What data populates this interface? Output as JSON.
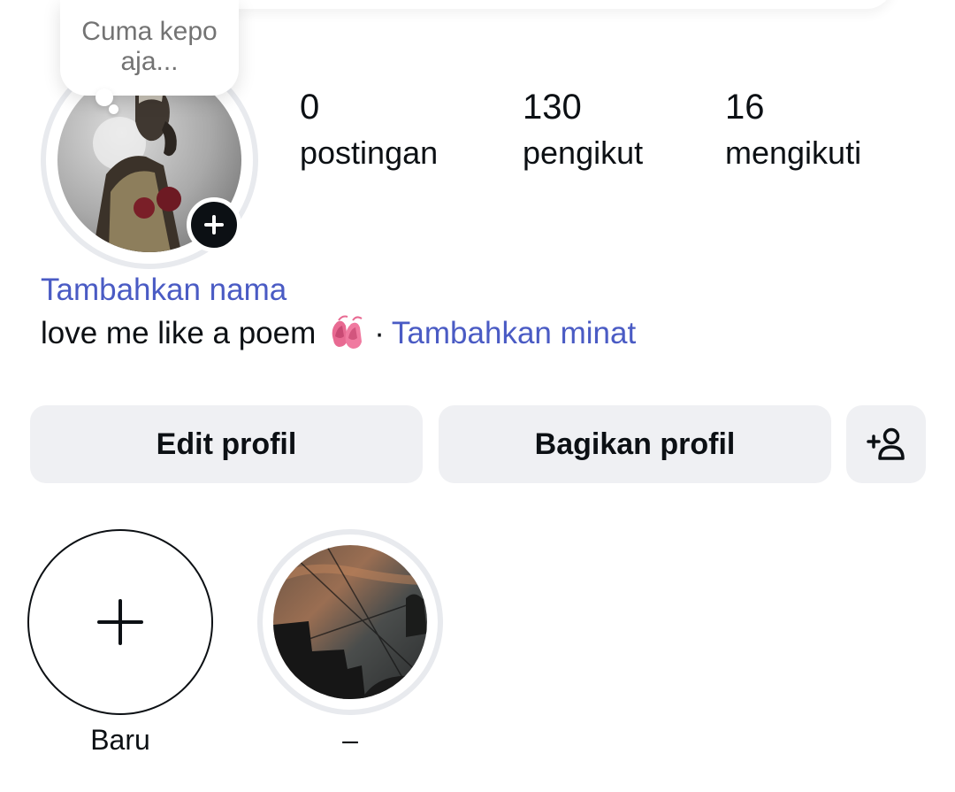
{
  "note": {
    "text": "Cuma kepo aja..."
  },
  "profile": {
    "avatar_alt": "profile-photo",
    "add_story_icon": "plus-icon"
  },
  "stats": {
    "posts": {
      "count": "0",
      "label": "postingan"
    },
    "followers": {
      "count": "130",
      "label": "pengikut"
    },
    "following": {
      "count": "16",
      "label": "mengikuti"
    }
  },
  "name_prompt": "Tambahkan nama",
  "bio": {
    "text": "love me like a poem",
    "emoji_icon": "ballet-shoes-icon",
    "separator": "·",
    "interests_link": "Tambahkan minat"
  },
  "actions": {
    "edit": "Edit profil",
    "share": "Bagikan profil",
    "discover_icon": "add-person-icon"
  },
  "highlights": [
    {
      "label": "Baru",
      "icon": "plus-icon"
    },
    {
      "label": "–",
      "icon": "highlight-cover"
    }
  ],
  "colors": {
    "link": "#4a5bc4",
    "button_bg": "#eff0f3",
    "ring": "#e8eaee",
    "text": "#0c1014",
    "muted": "#737373"
  }
}
